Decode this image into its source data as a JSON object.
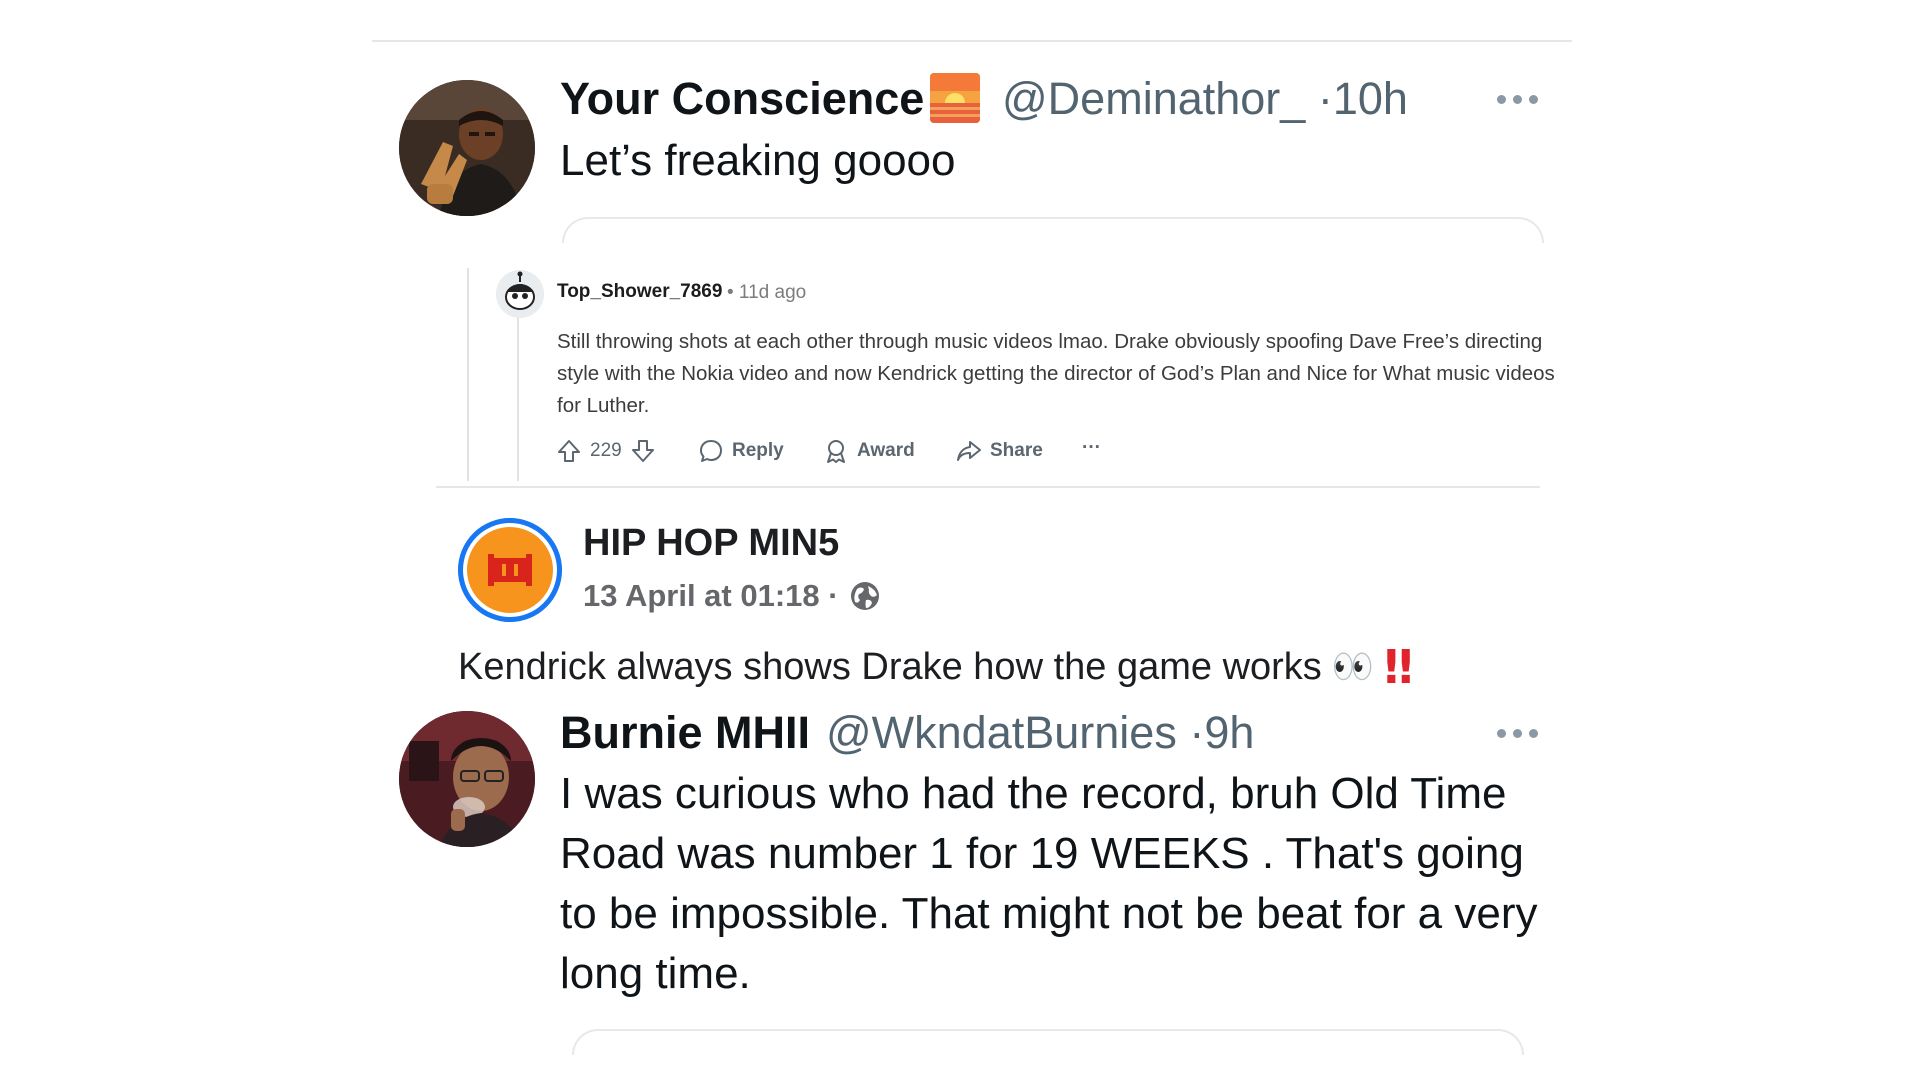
{
  "tweet1": {
    "name": "Your Conscience",
    "handle": "@Deminathor_",
    "separator": "·",
    "time": "10h",
    "text": "Let’s freaking goooo",
    "flag_icon": "sunrise-emoji-icon",
    "more_icon": "more-options-icon"
  },
  "reddit_comment": {
    "username": "Top_Shower_7869",
    "time": "• 11d ago",
    "body": "Still throwing shots at each other through music videos lmao. Drake obviously spoofing Dave Free’s directing style with the Nokia video and now Kendrick getting the director of God’s Plan and Nice for What music videos for Luther.",
    "votes": "229",
    "reply_label": "Reply",
    "award_label": "Award",
    "share_label": "Share",
    "more_label": "···"
  },
  "fb_post": {
    "page_name": "HIP HOP MIN5",
    "date": "13 April at 01:18 ·",
    "text": "Kendrick always shows Drake how the game works",
    "emoji_eyes": "👀",
    "emoji_exclaim": "‼"
  },
  "tweet2": {
    "name": "Burnie MHII",
    "handle": "@WkndatBurnies",
    "separator": "·",
    "time": "9h",
    "text": "I was curious who had the record, bruh Old Time Road was number 1 for 19 WEEKS . That's going to be impossible. That might not be beat for a very long time."
  },
  "colors": {
    "tweet_text": "#0f1419",
    "tweet_meta": "#536471",
    "reddit_meta": "#7c7c7c",
    "fb_ring": "#1877f2",
    "fb_avatar_fill": "#f7941d",
    "exclaim_red": "#e0242c"
  }
}
